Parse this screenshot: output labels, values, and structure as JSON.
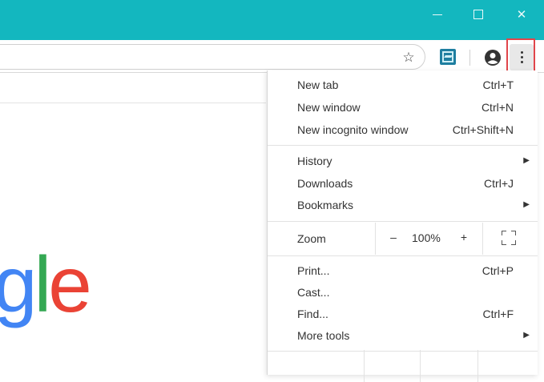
{
  "window": {
    "minimize_icon": "minimize-icon",
    "maximize_icon": "maximize-icon",
    "close_label": "✕"
  },
  "toolbar": {
    "star_label": "☆"
  },
  "page": {
    "logo_parts": [
      "g",
      "l",
      "e"
    ],
    "logo_colors": [
      "#4285f4",
      "#34a853",
      "#ea4335"
    ]
  },
  "menu": {
    "group1": [
      {
        "label": "New tab",
        "shortcut": "Ctrl+T"
      },
      {
        "label": "New window",
        "shortcut": "Ctrl+N"
      },
      {
        "label": "New incognito window",
        "shortcut": "Ctrl+Shift+N"
      }
    ],
    "group2": [
      {
        "label": "History",
        "shortcut": "",
        "submenu": true
      },
      {
        "label": "Downloads",
        "shortcut": "Ctrl+J"
      },
      {
        "label": "Bookmarks",
        "shortcut": "",
        "submenu": true
      }
    ],
    "zoom": {
      "label": "Zoom",
      "minus": "–",
      "value": "100%",
      "plus": "+"
    },
    "group3": [
      {
        "label": "Print...",
        "shortcut": "Ctrl+P"
      },
      {
        "label": "Cast...",
        "shortcut": ""
      },
      {
        "label": "Find...",
        "shortcut": "Ctrl+F"
      },
      {
        "label": "More tools",
        "shortcut": "",
        "submenu": true
      }
    ],
    "submenu_arrow": "▶"
  },
  "colors": {
    "titlebar": "#13b7bf",
    "highlight": "#e0464b"
  }
}
